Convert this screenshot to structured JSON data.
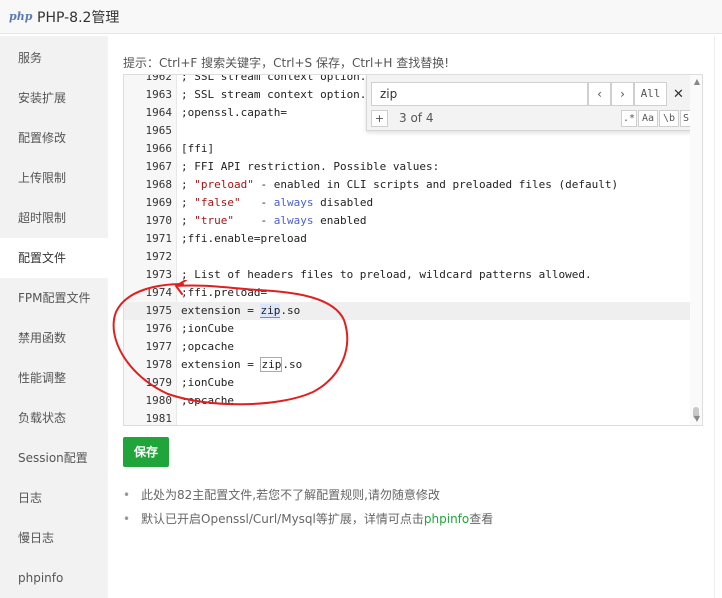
{
  "window": {
    "logo": "php",
    "title": "PHP-8.2管理"
  },
  "sidebar": {
    "items": [
      {
        "label": "服务"
      },
      {
        "label": "安装扩展"
      },
      {
        "label": "配置修改"
      },
      {
        "label": "上传限制"
      },
      {
        "label": "超时限制"
      },
      {
        "label": "配置文件",
        "active": true
      },
      {
        "label": "FPM配置文件"
      },
      {
        "label": "禁用函数"
      },
      {
        "label": "性能调整"
      },
      {
        "label": "负载状态"
      },
      {
        "label": "Session配置"
      },
      {
        "label": "日志"
      },
      {
        "label": "慢日志"
      },
      {
        "label": "phpinfo"
      }
    ]
  },
  "hint": "提示：Ctrl+F 搜索关键字，Ctrl+S 保存，Ctrl+H 查找替换!",
  "editor": {
    "partial_top": "; SSL stream context option...",
    "lines": [
      {
        "n": "1963",
        "text": "; SSL stream context option."
      },
      {
        "n": "1964",
        "text": ";openssl.capath="
      },
      {
        "n": "1965",
        "text": ""
      },
      {
        "n": "1966",
        "text": "[ffi]"
      },
      {
        "n": "1967",
        "text": "; FFI API restriction. Possible values:"
      },
      {
        "n": "1968",
        "text": "; \"preload\" - enabled in CLI scripts and preloaded files (default)"
      },
      {
        "n": "1969",
        "text": "; \"false\"   - always disabled"
      },
      {
        "n": "1970",
        "text": "; \"true\"    - always enabled"
      },
      {
        "n": "1971",
        "text": ";ffi.enable=preload"
      },
      {
        "n": "1972",
        "text": ""
      },
      {
        "n": "1973",
        "text": "; List of headers files to preload, wildcard patterns allowed."
      },
      {
        "n": "1974",
        "text": ";ffi.preload="
      },
      {
        "n": "1975",
        "text": "extension = zip.so",
        "active": true
      },
      {
        "n": "1976",
        "text": ";ionCube"
      },
      {
        "n": "1977",
        "text": ";opcache"
      },
      {
        "n": "1978",
        "text": "extension = zip.so"
      },
      {
        "n": "1979",
        "text": ";ionCube"
      },
      {
        "n": "1980",
        "text": ";opcache"
      },
      {
        "n": "1981",
        "text": ""
      }
    ]
  },
  "search": {
    "value": "zip",
    "prev_icon": "‹",
    "next_icon": "›",
    "all_label": "All",
    "close_icon": "✕",
    "plus_icon": "+",
    "count": "3 of 4",
    "regex_label": ".*",
    "case_label": "Aa",
    "word_label": "\\b",
    "in_selection_label": "S"
  },
  "save_label": "保存",
  "notes": {
    "note1": "此处为82主配置文件,若您不了解配置规则,请勿随意修改",
    "note2_prefix": "默认已开启Openssl/Curl/Mysql等扩展，详情可点击",
    "note2_link": "phpinfo",
    "note2_suffix": "查看"
  },
  "colors": {
    "accent": "#20a53a",
    "annotation": "#e02020"
  }
}
